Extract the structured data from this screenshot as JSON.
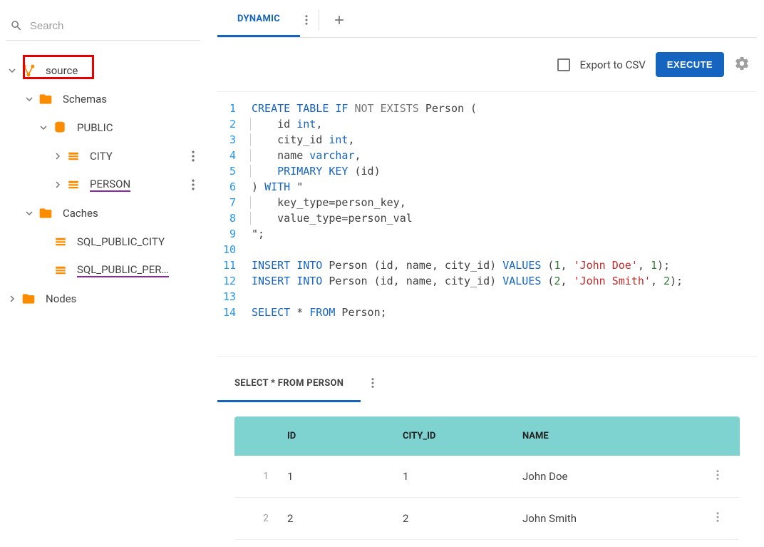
{
  "search": {
    "placeholder": "Search"
  },
  "tree": {
    "source": "source",
    "schemas": "Schemas",
    "public": "PUBLIC",
    "city": "CITY",
    "person": "PERSON",
    "caches": "Caches",
    "cache_city": "SQL_PUBLIC_CITY",
    "cache_person": "SQL_PUBLIC_PER…",
    "nodes": "Nodes"
  },
  "tabs": {
    "dynamic": "DYNAMIC"
  },
  "toolbar": {
    "export_csv": "Export to CSV",
    "execute": "EXECUTE"
  },
  "editor": {
    "lines": [
      {
        "n": 1,
        "tokens": [
          {
            "t": "CREATE TABLE",
            "c": "k"
          },
          {
            "t": " "
          },
          {
            "t": "IF",
            "c": "k"
          },
          {
            "t": " "
          },
          {
            "t": "NOT EXISTS",
            "c": "g"
          },
          {
            "t": " Person ("
          }
        ]
      },
      {
        "n": 2,
        "guide": true,
        "tokens": [
          {
            "t": "   id "
          },
          {
            "t": "int",
            "c": "k"
          },
          {
            "t": ","
          }
        ]
      },
      {
        "n": 3,
        "guide": true,
        "tokens": [
          {
            "t": "   city_id "
          },
          {
            "t": "int",
            "c": "k"
          },
          {
            "t": ","
          }
        ]
      },
      {
        "n": 4,
        "guide": true,
        "tokens": [
          {
            "t": "   name "
          },
          {
            "t": "varchar",
            "c": "k"
          },
          {
            "t": ","
          }
        ]
      },
      {
        "n": 5,
        "guide": true,
        "tokens": [
          {
            "t": "   "
          },
          {
            "t": "PRIMARY KEY",
            "c": "k"
          },
          {
            "t": " (id)"
          }
        ]
      },
      {
        "n": 6,
        "tokens": [
          {
            "t": ") "
          },
          {
            "t": "WITH",
            "c": "k"
          },
          {
            "t": " \""
          }
        ]
      },
      {
        "n": 7,
        "guide": true,
        "tokens": [
          {
            "t": "   key_type=person_key,"
          }
        ]
      },
      {
        "n": 8,
        "guide": true,
        "tokens": [
          {
            "t": "   value_type=person_val"
          }
        ]
      },
      {
        "n": 9,
        "tokens": [
          {
            "t": "\";"
          }
        ]
      },
      {
        "n": 10,
        "tokens": []
      },
      {
        "n": 11,
        "tokens": [
          {
            "t": "INSERT INTO",
            "c": "k"
          },
          {
            "t": " Person (id, name, city_id) "
          },
          {
            "t": "VALUES",
            "c": "k"
          },
          {
            "t": " ("
          },
          {
            "t": "1",
            "c": "n"
          },
          {
            "t": ", "
          },
          {
            "t": "'John Doe'",
            "c": "s"
          },
          {
            "t": ", "
          },
          {
            "t": "1",
            "c": "n"
          },
          {
            "t": ");"
          }
        ]
      },
      {
        "n": 12,
        "tokens": [
          {
            "t": "INSERT INTO",
            "c": "k"
          },
          {
            "t": " Person (id, name, city_id) "
          },
          {
            "t": "VALUES",
            "c": "k"
          },
          {
            "t": " ("
          },
          {
            "t": "2",
            "c": "n"
          },
          {
            "t": ", "
          },
          {
            "t": "'John Smith'",
            "c": "s"
          },
          {
            "t": ", "
          },
          {
            "t": "2",
            "c": "n"
          },
          {
            "t": ");"
          }
        ]
      },
      {
        "n": 13,
        "tokens": []
      },
      {
        "n": 14,
        "tokens": [
          {
            "t": "SELECT",
            "c": "k"
          },
          {
            "t": " * "
          },
          {
            "t": "FROM",
            "c": "k"
          },
          {
            "t": " Person;"
          }
        ]
      }
    ]
  },
  "result": {
    "tab": "SELECT * FROM PERSON",
    "headers": {
      "id": "ID",
      "city_id": "CITY_ID",
      "name": "NAME"
    },
    "rows": [
      {
        "idx": "1",
        "id": "1",
        "city_id": "1",
        "name": "John Doe"
      },
      {
        "idx": "2",
        "id": "2",
        "city_id": "2",
        "name": "John Smith"
      }
    ]
  }
}
